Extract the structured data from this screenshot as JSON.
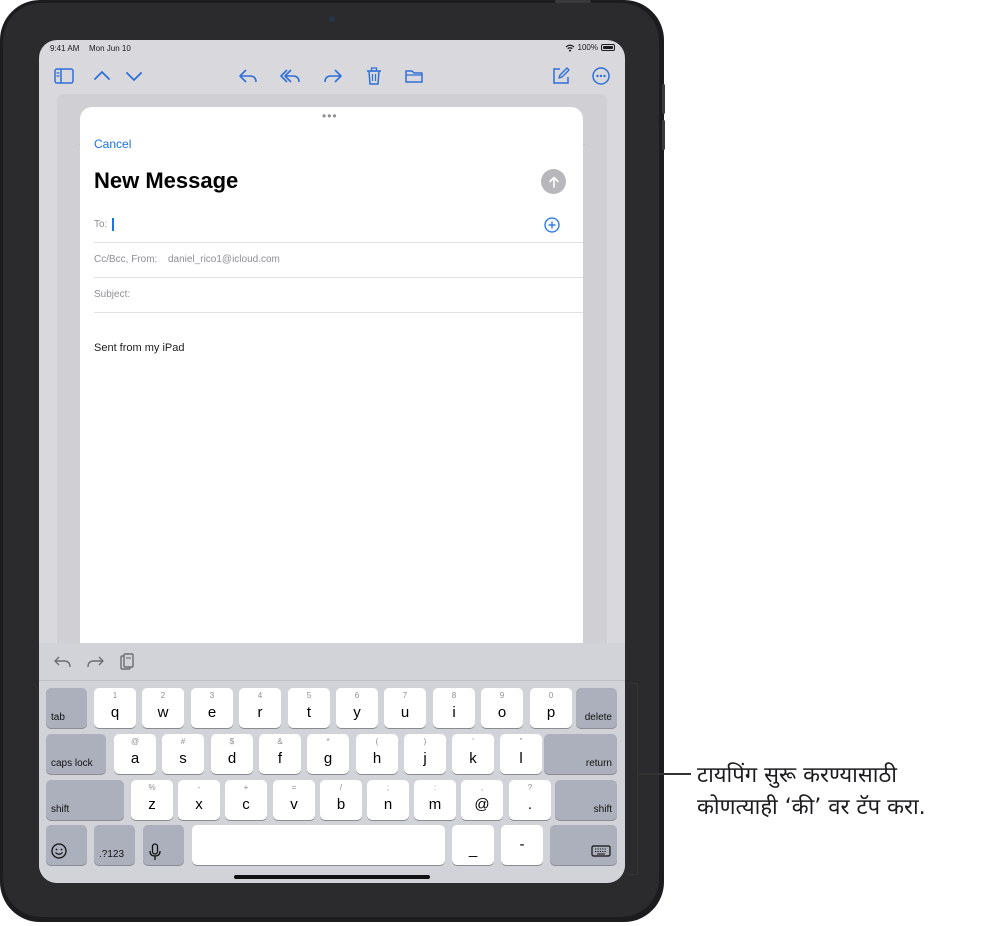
{
  "status_bar": {
    "time": "9:41 AM",
    "date": "Mon Jun 10",
    "battery": "100%"
  },
  "toolbar_icons": [
    "sidebar-icon",
    "chevron-up-icon",
    "chevron-down-icon",
    "reply-icon",
    "reply-all-icon",
    "forward-icon",
    "trash-icon",
    "folder-icon",
    "compose-icon",
    "more-icon"
  ],
  "compose": {
    "cancel_label": "Cancel",
    "title": "New Message",
    "to_label": "To:",
    "cc_label": "Cc/Bcc, From:",
    "from_address": "daniel_rico1@icloud.com",
    "subject_label": "Subject:",
    "body": "Sent from my iPad"
  },
  "keyboard": {
    "row1": [
      {
        "k": "q",
        "a": "1"
      },
      {
        "k": "w",
        "a": "2"
      },
      {
        "k": "e",
        "a": "3"
      },
      {
        "k": "r",
        "a": "4"
      },
      {
        "k": "t",
        "a": "5"
      },
      {
        "k": "y",
        "a": "6"
      },
      {
        "k": "u",
        "a": "7"
      },
      {
        "k": "i",
        "a": "8"
      },
      {
        "k": "o",
        "a": "9"
      },
      {
        "k": "p",
        "a": "0"
      }
    ],
    "row2": [
      {
        "k": "a",
        "a": "@"
      },
      {
        "k": "s",
        "a": "#"
      },
      {
        "k": "d",
        "a": "$"
      },
      {
        "k": "f",
        "a": "&"
      },
      {
        "k": "g",
        "a": "*"
      },
      {
        "k": "h",
        "a": "("
      },
      {
        "k": "j",
        "a": ")"
      },
      {
        "k": "k",
        "a": "'"
      },
      {
        "k": "l",
        "a": "\""
      }
    ],
    "row3": [
      {
        "k": "z",
        "a": "%"
      },
      {
        "k": "x",
        "a": "-"
      },
      {
        "k": "c",
        "a": "+"
      },
      {
        "k": "v",
        "a": "="
      },
      {
        "k": "b",
        "a": "/"
      },
      {
        "k": "n",
        "a": ";"
      },
      {
        "k": "m",
        "a": ":"
      },
      {
        "k": "@",
        "a": ","
      },
      {
        "k": ".",
        "a": "?"
      }
    ],
    "tab": "tab",
    "delete": "delete",
    "caps_lock": "caps lock",
    "return": "return",
    "shift": "shift",
    "numbers": ".?123",
    "underscore": "_",
    "dash": "-"
  },
  "callout": {
    "line1": "टायपिंग सुरू करण्यासाठी",
    "line2": "कोणत्याही ‘की’ वर टॅप करा."
  }
}
